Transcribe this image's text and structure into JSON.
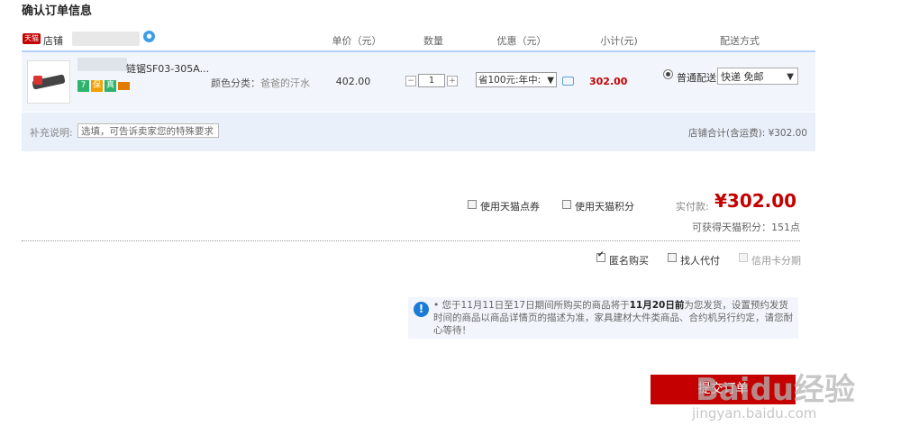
{
  "page_title": "确认订单信息",
  "shop": {
    "logo_text": "天猫",
    "label": "店铺"
  },
  "columns": [
    "单价（元）",
    "数量",
    "优惠（元）",
    "小计(元)",
    "配送方式"
  ],
  "item": {
    "name": "链锯SF03-305A...",
    "badges": [
      {
        "text": "7",
        "color": "#2db36b"
      },
      {
        "text": "保",
        "color": "#f0a000"
      },
      {
        "text": "真",
        "color": "#2db36b"
      },
      {
        "text": "",
        "color": "#e07b00"
      }
    ],
    "sku_label": "颜色分类：",
    "sku_value": "爸爸的汗水",
    "unit_price": "402.00",
    "quantity": "1",
    "qty_minus": "−",
    "qty_plus": "+",
    "promo_selected": "省100元:年中:",
    "subtotal": "302.00",
    "shipping_option_label": "普通配送",
    "shipping_method": "快递 免邮"
  },
  "remarks": {
    "label": "补充说明:",
    "placeholder": "选填，可告诉卖家您的特殊要求",
    "shop_total": "店铺合计(含运费): ¥302.00"
  },
  "options": {
    "use_coupon": "使用天猫点券",
    "use_points": "使用天猫积分",
    "anonymous": "匿名购买",
    "find_payer": "找人代付",
    "credit_installment": "信用卡分期"
  },
  "payment": {
    "label": "实付款:",
    "amount": "¥302.00",
    "points_text": "可获得天猫积分：151点"
  },
  "notice": {
    "text_before": "• 您于11月11日至17日期间所购买的商品将于",
    "text_bold": "11月20日前",
    "text_after": "为您发货，设置预约发货时间的商品以商品详情页的描述为准，家具建材大件类商品、合约机另行约定，请您耐心等待！"
  },
  "submit_label": "提交订单",
  "watermark": {
    "brand": "Baidu经验",
    "url": "jingyan.baidu.com"
  },
  "colors": {
    "accent_red": "#c40000",
    "header_line": "#b2d1ff",
    "row_bg": "#f2f6fc"
  }
}
